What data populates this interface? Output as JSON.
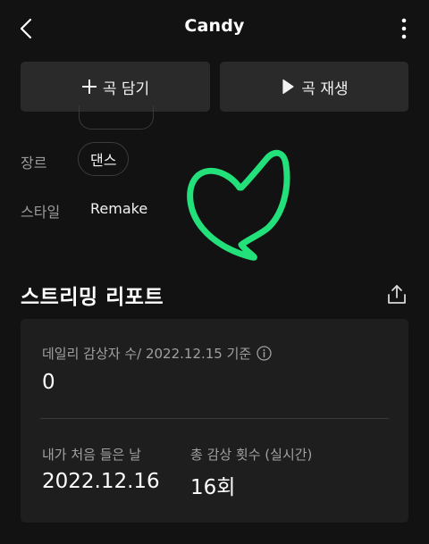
{
  "header": {
    "title": "Candy"
  },
  "actions": {
    "add_label": "곡 담기",
    "play_label": "곡 재생"
  },
  "info": {
    "genre_label": "장르",
    "genre_value": "댄스",
    "style_label": "스타일",
    "style_value": "Remake"
  },
  "doodle": {
    "color": "#22e07a"
  },
  "report": {
    "title": "스트리밍 리포트",
    "daily_label": "데일리 감상자 수/ 2022.12.15 기준",
    "daily_value": "0",
    "first_listen_label": "내가 처음 들은 날",
    "first_listen_value": "2022.12.16",
    "total_plays_label": "총 감상 횟수 (실시간)",
    "total_plays_value": "16회"
  },
  "icons": {
    "back": "chevron-left-icon",
    "more": "more-vertical-icon",
    "add": "plus-icon",
    "play": "play-icon",
    "share": "share-icon",
    "info": "info-icon"
  }
}
